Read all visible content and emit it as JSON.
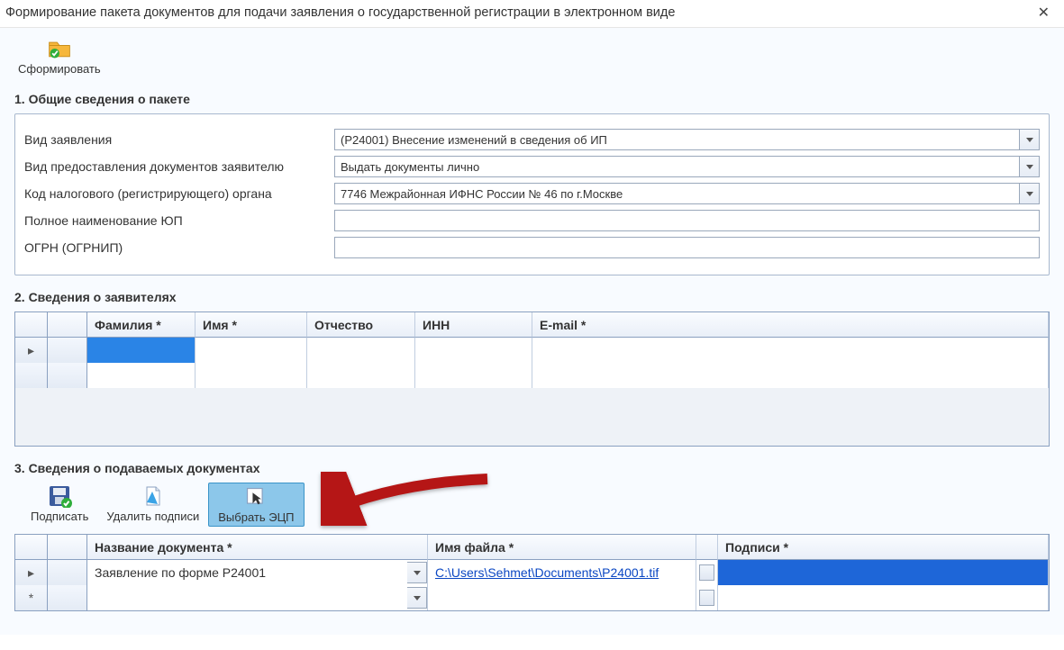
{
  "window": {
    "title": "Формирование пакета документов для подачи заявления о государственной регистрации в электронном виде"
  },
  "toolbar": {
    "form_label": "Сформировать"
  },
  "section1": {
    "title": "1. Общие сведения о пакете",
    "labels": {
      "app_type": "Вид заявления",
      "delivery": "Вид предоставления документов заявителю",
      "tax_code": "Код налогового (регистрирующего) органа",
      "org_name": "Полное наименование ЮП",
      "ogrn": "ОГРН (ОГРНИП)"
    },
    "values": {
      "app_type": "(Р24001) Внесение изменений в сведения об ИП",
      "delivery": "Выдать документы лично",
      "tax_code": "7746 Межрайонная ИФНС России № 46 по г.Москве",
      "org_name": "",
      "ogrn": ""
    }
  },
  "section2": {
    "title": "2. Сведения о заявителях",
    "headers": {
      "fam": "Фамилия *",
      "imya": "Имя *",
      "ot": "Отчество",
      "inn": "ИНН",
      "email": "E-mail *"
    },
    "rows": [
      {
        "fam": "",
        "imya": "",
        "ot": "",
        "inn": "",
        "email": ""
      }
    ]
  },
  "section3": {
    "title": "3. Сведения о подаваемых документах",
    "tools": {
      "sign": "Подписать",
      "unsign": "Удалить подписи",
      "choose": "Выбрать ЭЦП"
    },
    "headers": {
      "name": "Название документа *",
      "file": "Имя файла *",
      "sign": "Подписи *"
    },
    "rows": [
      {
        "name": "Заявление по форме Р24001",
        "file": "C:\\Users\\Sehmet\\Documents\\P24001.tif",
        "sign": ""
      }
    ]
  }
}
